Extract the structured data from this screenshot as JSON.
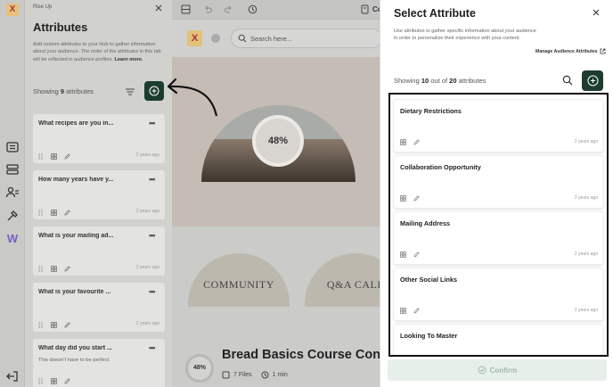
{
  "rail": {
    "logo": "X",
    "w_logo": "W"
  },
  "attributes_panel": {
    "hub_name": "Rise Up",
    "title": "Attributes",
    "description": "Add custom attributes to your Hub to gather information about your audience. The order of the attributes in this tab will be reflected in audience profiles.",
    "learn_more": "Learn more.",
    "showing_prefix": "Showing",
    "showing_count": "9",
    "showing_suffix": "attributes",
    "cards": [
      {
        "title": "What recipes are you in...",
        "subtitle": "",
        "time": "2 years ago"
      },
      {
        "title": "How many years have y...",
        "subtitle": "",
        "time": "2 years ago"
      },
      {
        "title": "What is your mailing ad...",
        "subtitle": "",
        "time": "2 years ago"
      },
      {
        "title": "What is your favourite ...",
        "subtitle": "",
        "time": "2 years ago"
      },
      {
        "title": "What day did you start ...",
        "subtitle": "This doesn't have to be perfect.",
        "time": ""
      }
    ]
  },
  "editor": {
    "toolbar_text": "Co",
    "logo": "X",
    "search_placeholder": "Search here...",
    "progress_label": "48%",
    "progress_value": 0.48,
    "arches": [
      "COMMUNITY",
      "Q&A CALL"
    ],
    "course_progress": "48%",
    "course_title": "Bread Basics Course Con",
    "files": "7 Files",
    "duration": "1 min"
  },
  "dialog": {
    "title": "Select Attribute",
    "description": "Use attributes to gather specific information about your audience in order to personalize their experience with your content.",
    "manage_link": "Manage Audience Attributes",
    "showing_prefix": "Showing",
    "showing_count": "10",
    "showing_middle": "out of",
    "showing_total": "20",
    "showing_suffix": "attributes",
    "items": [
      {
        "title": "Dietary Restrictions",
        "time": "2 years ago"
      },
      {
        "title": "Collaboration Opportunity",
        "time": "2 years ago"
      },
      {
        "title": "Mailing Address",
        "time": "2 years ago"
      },
      {
        "title": "Other Social Links",
        "time": "2 years ago"
      },
      {
        "title": "Looking To Master",
        "time": ""
      }
    ],
    "confirm_label": "Confirm"
  },
  "colors": {
    "accent_dark_green": "#1c3d2e",
    "confirm_disabled": "#e6efe9"
  }
}
